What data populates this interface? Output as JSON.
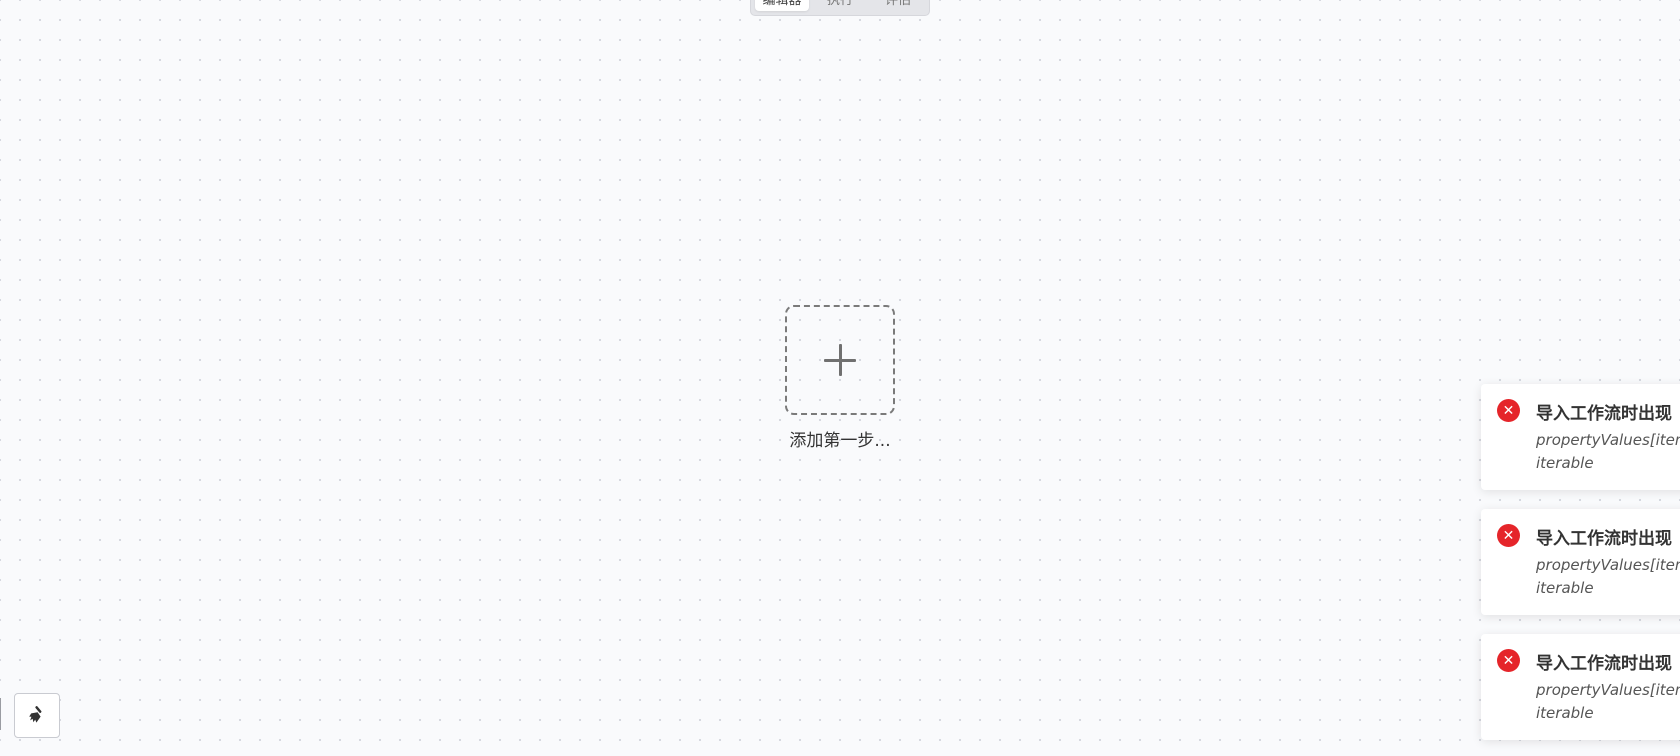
{
  "tabs": [
    {
      "label": "编辑器",
      "active": true
    },
    {
      "label": "执行",
      "active": false
    },
    {
      "label": "评估",
      "active": false
    }
  ],
  "canvas": {
    "add_step_label": "添加第一步..."
  },
  "toolbar": {
    "clean_icon": "broom-icon"
  },
  "notifications": [
    {
      "title": "导入工作流时出现",
      "message_line1": "propertyValues[item",
      "message_line2": "iterable",
      "icon": "error-icon",
      "color": "#e5252a"
    },
    {
      "title": "导入工作流时出现",
      "message_line1": "propertyValues[item",
      "message_line2": "iterable",
      "icon": "error-icon",
      "color": "#e5252a"
    },
    {
      "title": "导入工作流时出现",
      "message_line1": "propertyValues[item",
      "message_line2": "iterable",
      "icon": "error-icon",
      "color": "#e5252a"
    }
  ]
}
